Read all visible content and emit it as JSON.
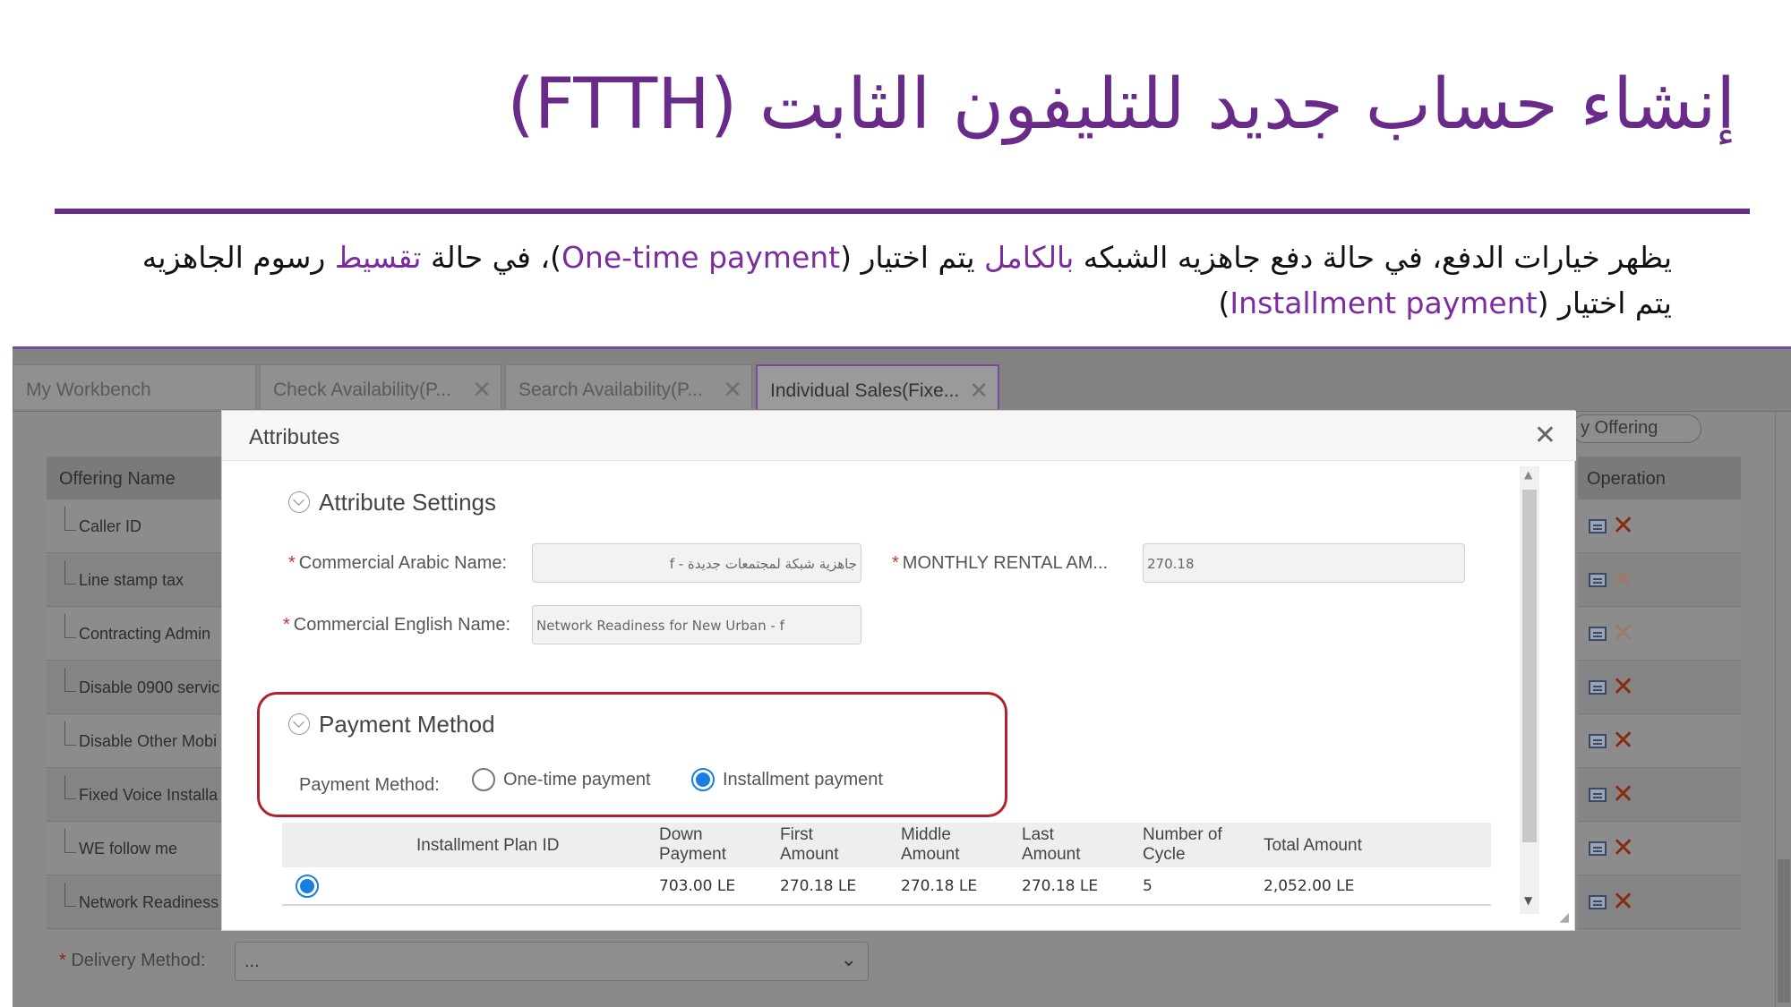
{
  "slide": {
    "title": "إنشاء حساب جديد للتليفون الثابت (FTTH)",
    "desc_p1": "يظهر خيارات الدفع، في حالة دفع جاهزيه الشبكه ",
    "desc_hl1": "بالكامل",
    "desc_p2": " يتم اختيار (",
    "desc_hl2": "One-time payment",
    "desc_p3": ")، في حالة ",
    "desc_hl3": "تقسيط",
    "desc_p4": " رسوم الجاهزيه يتم اختيار (",
    "desc_hl4": "Installment payment",
    "desc_p5": ")"
  },
  "tabs": [
    {
      "label": "My Workbench"
    },
    {
      "label": "Check Availability(P..."
    },
    {
      "label": "Search Availability(P..."
    },
    {
      "label": "Individual Sales(Fixe..."
    }
  ],
  "tab_close_glyph": "✕",
  "background_table": {
    "header": "Offering Name",
    "rows": [
      "Caller ID",
      "Line stamp tax",
      "Contracting Admin",
      "Disable 0900 servic",
      "Disable Other Mobi",
      "Fixed Voice Installa",
      "WE follow me",
      "Network Readiness"
    ],
    "operation_header": "Operation",
    "query_button": "y Offering"
  },
  "delivery": {
    "label": "Delivery Method:",
    "value": "..."
  },
  "modal": {
    "title": "Attributes",
    "close": "✕",
    "attribute_settings": {
      "heading": "Attribute Settings",
      "arabic_name_label": "Commercial Arabic Name:",
      "arabic_name_value": "جاهزية شبكة لمجتمعات جديدة - f",
      "english_name_label": "Commercial English Name:",
      "english_name_value": "Network Readiness for New Urban - f",
      "monthly_label": "MONTHLY RENTAL AM...",
      "monthly_value": "270.18"
    },
    "payment": {
      "heading": "Payment Method",
      "label": "Payment Method:",
      "options": [
        {
          "label": "One-time payment",
          "selected": false
        },
        {
          "label": "Installment payment",
          "selected": true
        }
      ]
    },
    "installment_table": {
      "headers": {
        "plan_id": "Installment Plan ID",
        "down_1": "Down",
        "down_2": "Payment",
        "first_1": "First",
        "first_2": "Amount",
        "middle_1": "Middle",
        "middle_2": "Amount",
        "last_1": "Last",
        "last_2": "Amount",
        "cycle_1": "Number of",
        "cycle_2": "Cycle",
        "total": "Total Amount"
      },
      "row": {
        "selected": true,
        "down": "703.00 LE",
        "first": "270.18 LE",
        "middle": "270.18 LE",
        "last": "270.18 LE",
        "cycles": "5",
        "total": "2,052.00 LE"
      }
    }
  },
  "colors": {
    "accent_purple": "#6a2a8a",
    "highlight_box": "#b3212a",
    "radio_blue": "#1a7de0"
  }
}
